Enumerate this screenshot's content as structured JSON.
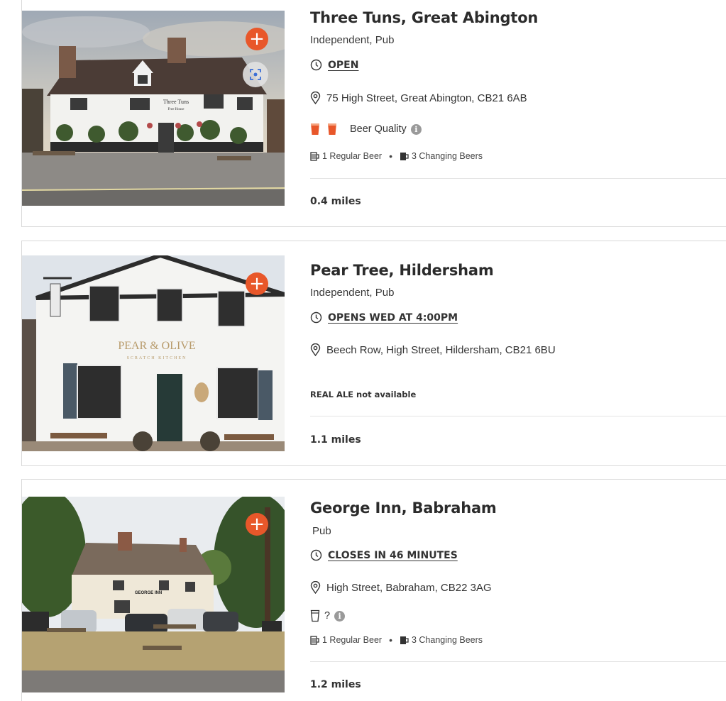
{
  "pubs": [
    {
      "name": "Three Tuns, Great Abington",
      "type": "Independent, Pub",
      "hours_status": "OPEN",
      "address": "75 High Street, Great Abington, CB21 6AB",
      "beer_quality_label": "Beer Quality",
      "beer_quality_pints": 2,
      "regular_beers": "1 Regular Beer",
      "changing_beers": "3 Changing Beers",
      "distance": "0.4 miles",
      "photo_sign_line1": "Three Tuns",
      "photo_sign_line2": "Free House"
    },
    {
      "name": "Pear Tree, Hildersham",
      "type": "Independent, Pub",
      "hours_status": "OPENS WED AT 4:00PM",
      "address": "Beech Row, High Street, Hildersham, CB21 6BU",
      "real_ale_note": "REAL ALE not available",
      "distance": "1.1 miles",
      "photo_sign_line1": "PEAR & OLIVE",
      "photo_sign_line2": "SCRATCH KITCHEN"
    },
    {
      "name": "George Inn, Babraham",
      "type": "Pub",
      "hours_status": "CLOSES IN 46 MINUTES",
      "address": "High Street, Babraham, CB22 3AG",
      "beer_quality_unknown": "?",
      "regular_beers": "1 Regular Beer",
      "changing_beers": "3 Changing Beers",
      "distance": "1.2 miles",
      "photo_sign_line1": "GEORGE INN"
    }
  ],
  "controls": {
    "add_symbol": "+"
  },
  "colors": {
    "accent": "#e8572a",
    "pint": "#e8572a",
    "divider": "#e3e3e3"
  },
  "icons": [
    "clock-icon",
    "map-pin-icon",
    "pint-icon",
    "info-icon",
    "handpump-icon",
    "lens-icon",
    "plus-icon"
  ]
}
